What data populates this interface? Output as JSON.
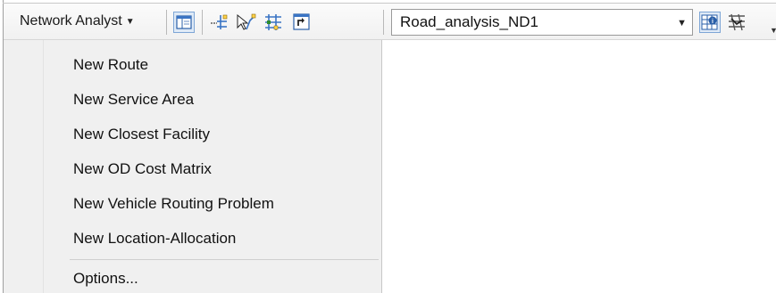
{
  "toolbar": {
    "network_analyst_label": "Network Analyst",
    "network_dataset_value": "Road_analysis_ND1",
    "icons": [
      "network-analyst-window-icon",
      "create-network-location-icon",
      "select-move-location-icon",
      "solve-grid-icon",
      "directions-window-icon",
      "build-network-icon",
      "network-identify-icon"
    ]
  },
  "menu": {
    "items": [
      {
        "label": "New Route"
      },
      {
        "label": "New Service Area"
      },
      {
        "label": "New Closest Facility"
      },
      {
        "label": "New OD Cost Matrix"
      },
      {
        "label": "New Vehicle Routing Problem"
      },
      {
        "label": "New Location-Allocation"
      }
    ],
    "options_label": "Options..."
  },
  "colors": {
    "toolbar_bg": "#f4f4f4",
    "menu_bg": "#f0f0f0",
    "active_icon_bg": "#dfeaf7",
    "active_icon_border": "#7ea6d6"
  }
}
